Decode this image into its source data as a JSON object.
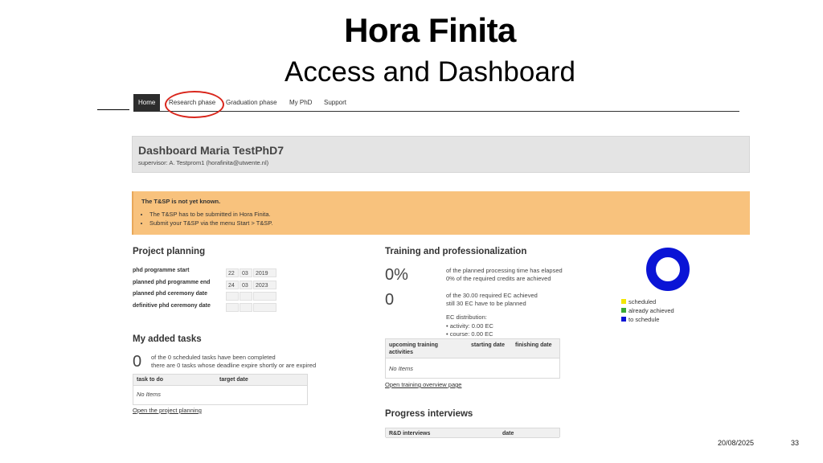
{
  "slide": {
    "title": "Hora Finita",
    "subtitle": "Access and Dashboard",
    "date": "20/08/2025",
    "page_number": "33"
  },
  "nav": {
    "items": [
      {
        "label": "Home",
        "active": true
      },
      {
        "label": "Research phase",
        "active": false,
        "highlighted": true
      },
      {
        "label": "Graduation phase",
        "active": false
      },
      {
        "label": "My PhD",
        "active": false
      },
      {
        "label": "Support",
        "active": false
      }
    ]
  },
  "dashboard": {
    "title": "Dashboard Maria TestPhD7",
    "supervisor": "supervisor: A. Testprom1 (horafinita@utwente.nl)"
  },
  "alert": {
    "title": "The T&SP is not yet known.",
    "items": [
      "The T&SP has to be submitted in Hora Finita.",
      "Submit your T&SP via the menu Start > T&SP."
    ]
  },
  "project_planning": {
    "title": "Project planning",
    "rows": [
      {
        "label": "phd programme start",
        "day": "22",
        "month": "03",
        "year": "2019"
      },
      {
        "label": "planned phd programme end",
        "day": "24",
        "month": "03",
        "year": "2023"
      },
      {
        "label": "planned phd ceremony date",
        "day": "",
        "month": "",
        "year": ""
      },
      {
        "label": "definitive phd ceremony date",
        "day": "",
        "month": "",
        "year": ""
      }
    ]
  },
  "added_tasks": {
    "title": "My added tasks",
    "count": "0",
    "line1": "of the 0 scheduled tasks have been completed",
    "line2": "there are 0 tasks whose deadline expire shortly or are expired",
    "col1": "task to do",
    "col2": "target date",
    "empty": "No Items",
    "link": "Open the project planning"
  },
  "training": {
    "title": "Training and professionalization",
    "percent": "0%",
    "percent_line1": "of the planned processing time has elapsed",
    "percent_line2": "0% of the required credits are achieved",
    "ec": "0",
    "ec_line1": "of the 30.00 required EC achieved",
    "ec_line2": "still 30 EC have to be planned",
    "dist_title": "EC distribution:",
    "dist_activity": "• activity:  0.00 EC",
    "dist_course": "• course:   0.00 EC",
    "col1": "upcoming training activities",
    "col2": "starting date",
    "col3": "finishing date",
    "empty": "No Items",
    "link": "Open training overview page",
    "legend": [
      {
        "label": "scheduled",
        "color": "#f2e600"
      },
      {
        "label": "already achieved",
        "color": "#3aa935"
      },
      {
        "label": "to schedule",
        "color": "#0a14d6"
      }
    ],
    "donut_fraction_to_schedule": 1.0
  },
  "progress": {
    "title": "Progress interviews",
    "col1": "R&D interviews",
    "col2": "date"
  }
}
